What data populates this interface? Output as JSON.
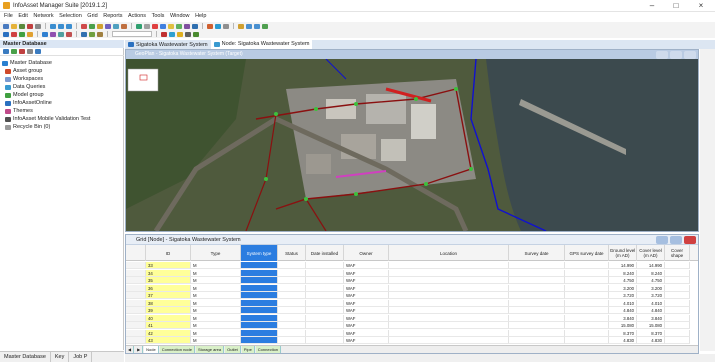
{
  "app": {
    "title": "InfoAsset Manager Suite [2019.1.2]"
  },
  "menu": [
    "File",
    "Edit",
    "Network",
    "Selection",
    "Grid",
    "Reports",
    "Actions",
    "Tools",
    "Window",
    "Help"
  ],
  "colors": {
    "accent": "#1a6fd0",
    "systemtype": "#2b7de0",
    "idcol": "#ffff99",
    "redline": "#d02020",
    "blueline": "#1010d0"
  },
  "left_panel": {
    "header": "Master Database",
    "tree": [
      {
        "label": "Master Database",
        "icon": "database-icon"
      },
      {
        "label": "Asset group",
        "icon": "folder-icon"
      },
      {
        "label": "Workspaces",
        "icon": "folder-icon"
      },
      {
        "label": "Data Queries",
        "icon": "folder-icon"
      },
      {
        "label": "Model group",
        "icon": "folder-icon"
      },
      {
        "label": "InfoAssetOnline",
        "icon": "cloud-icon"
      },
      {
        "label": "Themes",
        "icon": "folder-icon"
      },
      {
        "label": "InfoAsset Mobile Validation Test",
        "icon": "folder-icon"
      },
      {
        "label": "Recycle Bin (0)",
        "icon": "recycle-bin-icon"
      }
    ],
    "bottom_tabs": [
      "Master Database",
      "Key",
      "Job P"
    ]
  },
  "doc_tabs": [
    "Sigatoka Wastewater System",
    "Node: Sigatoka Wastewater System"
  ],
  "map_window": {
    "caption": "GeoPlan - Sigatoka Wastewater System (Target)"
  },
  "grid_window": {
    "caption": "Grid [Node] - Sigatoka Wastewater System",
    "columns": [
      "ID",
      "Type",
      "System type",
      "Status",
      "Date installed",
      "Owner",
      "Location",
      "Survey date",
      "GPS survey date",
      "Ground level (m AD)",
      "Cover level (m AD)",
      "Cover shape"
    ],
    "rows": [
      {
        "id": "33",
        "type": "M",
        "owner": "WAF",
        "ground": "14.990",
        "cover": "14.990"
      },
      {
        "id": "34",
        "type": "M",
        "owner": "WAF",
        "ground": "8.240",
        "cover": "8.240"
      },
      {
        "id": "35",
        "type": "M",
        "owner": "WAF",
        "ground": "4.750",
        "cover": "4.750"
      },
      {
        "id": "36",
        "type": "M",
        "owner": "WAF",
        "ground": "3.200",
        "cover": "3.200"
      },
      {
        "id": "37",
        "type": "M",
        "owner": "WAF",
        "ground": "3.720",
        "cover": "3.720"
      },
      {
        "id": "38",
        "type": "M",
        "owner": "WAF",
        "ground": "4.010",
        "cover": "4.010"
      },
      {
        "id": "39",
        "type": "M",
        "owner": "WAF",
        "ground": "4.840",
        "cover": "4.840"
      },
      {
        "id": "40",
        "type": "M",
        "owner": "WAF",
        "ground": "3.840",
        "cover": "3.840"
      },
      {
        "id": "41",
        "type": "M",
        "owner": "WAF",
        "ground": "15.080",
        "cover": "15.080"
      },
      {
        "id": "42",
        "type": "M",
        "owner": "WAF",
        "ground": "8.370",
        "cover": "8.370"
      },
      {
        "id": "43",
        "type": "M",
        "owner": "WAF",
        "ground": "4.830",
        "cover": "4.830"
      }
    ],
    "sheet_tabs": [
      "Node",
      "Connection node",
      "Storage area",
      "Outlet",
      "Pipe",
      "Connection"
    ]
  }
}
